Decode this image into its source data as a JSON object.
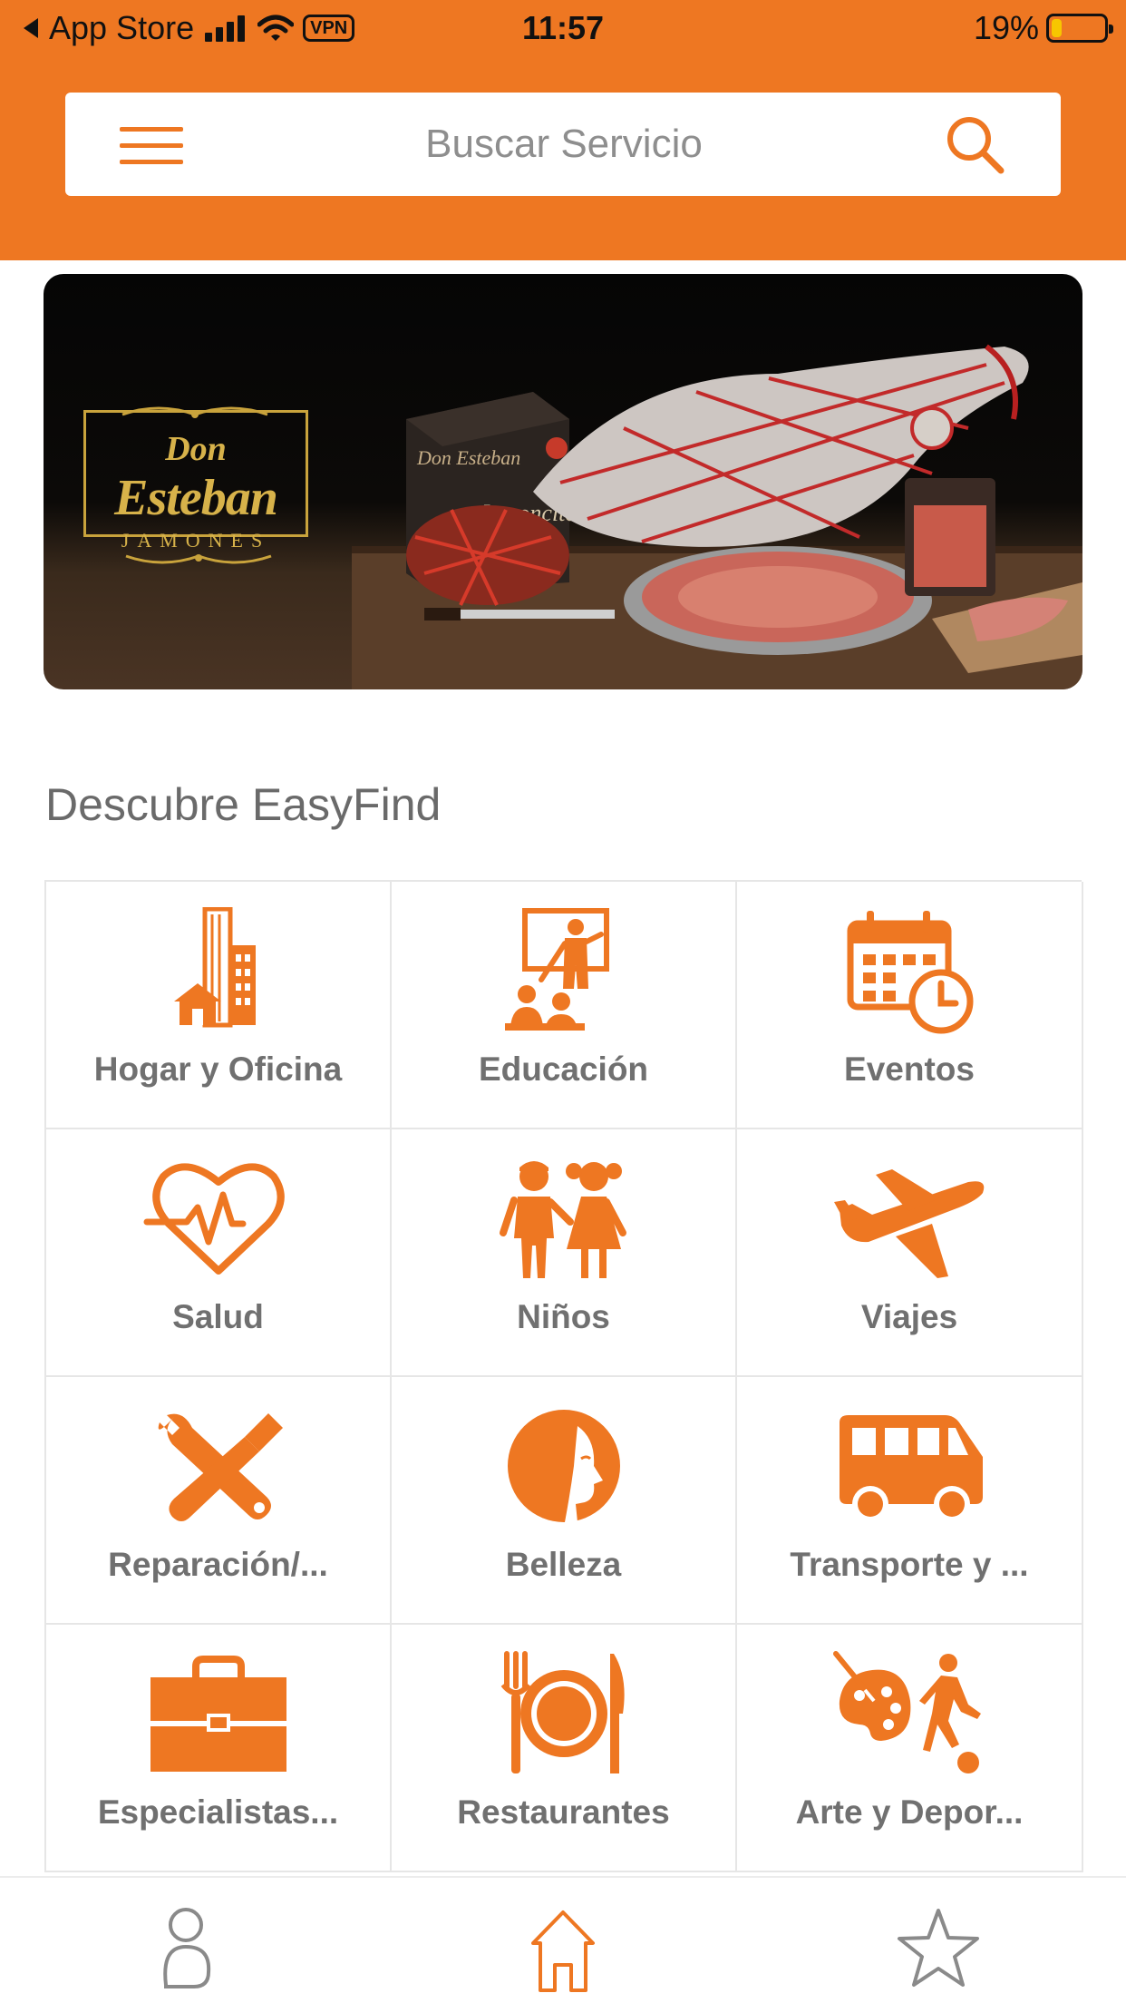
{
  "status_bar": {
    "back_label": "App Store",
    "vpn": "VPN",
    "time": "11:57",
    "battery": "19%",
    "battery_level": 0.19
  },
  "search": {
    "placeholder": "Buscar Servicio"
  },
  "banner": {
    "logo_line1": "Don",
    "logo_line2": "Esteban",
    "logo_line3": "JAMONES",
    "box_brand": "Don Esteban",
    "box_product": "Jamoncito"
  },
  "section_title": "Descubre EasyFind",
  "categories": [
    {
      "label": "Hogar y Oficina",
      "icon": "building-home-icon"
    },
    {
      "label": "Educación",
      "icon": "teacher-board-icon"
    },
    {
      "label": "Eventos",
      "icon": "calendar-clock-icon"
    },
    {
      "label": "Salud",
      "icon": "heart-pulse-icon"
    },
    {
      "label": "Niños",
      "icon": "children-icon"
    },
    {
      "label": "Viajes",
      "icon": "airplane-icon"
    },
    {
      "label": "Reparación/...",
      "icon": "wrench-screwdriver-icon"
    },
    {
      "label": "Belleza",
      "icon": "woman-face-icon"
    },
    {
      "label": "Transporte y ...",
      "icon": "van-icon"
    },
    {
      "label": "Especialistas...",
      "icon": "briefcase-icon"
    },
    {
      "label": "Restaurantes",
      "icon": "plate-cutlery-icon"
    },
    {
      "label": "Arte y Depor...",
      "icon": "palette-soccer-icon"
    }
  ],
  "bottom_nav": [
    {
      "name": "profile",
      "icon": "user-icon"
    },
    {
      "name": "home",
      "icon": "home-icon",
      "active": true
    },
    {
      "name": "favorites",
      "icon": "star-icon"
    }
  ],
  "colors": {
    "accent": "#EE7722",
    "header_bg": "#EE7722",
    "label_gray": "#707070",
    "logo_gold": "#D7B24A"
  }
}
